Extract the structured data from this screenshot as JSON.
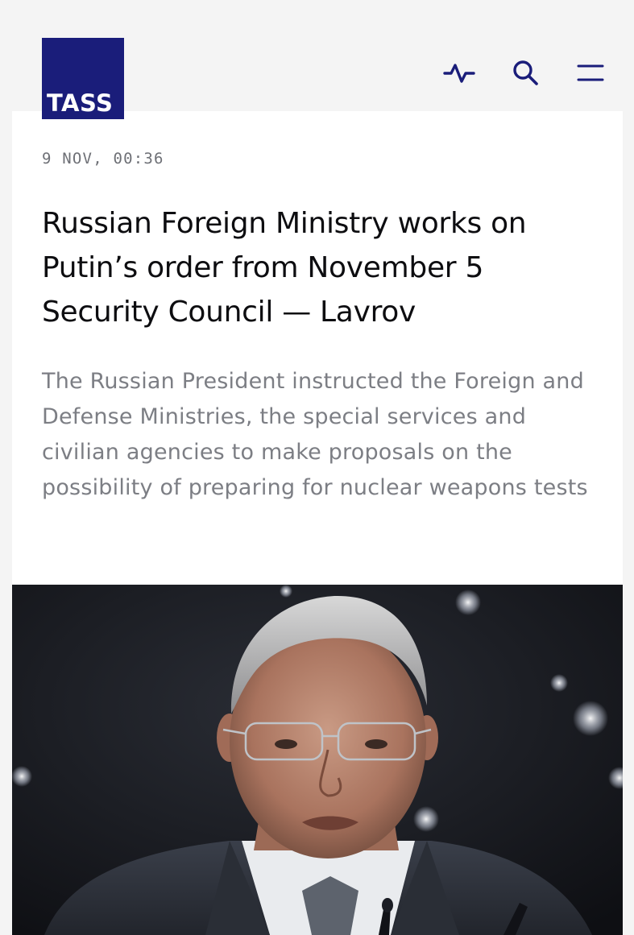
{
  "header": {
    "logo_text": "TASS",
    "icons": [
      "activity-icon",
      "search-icon",
      "menu-icon"
    ],
    "brand_color": "#1a1d7a"
  },
  "article": {
    "timestamp": "9 NOV, 00:36",
    "headline": "Russian Foreign Ministry works on Putin’s order from November 5 Security Council — Lavrov",
    "lead": "The Russian President instructed the Foreign and Defense Ministries, the special services and civilian agencies to make proposals on the possibility of preparing for nuclear weapons tests"
  }
}
